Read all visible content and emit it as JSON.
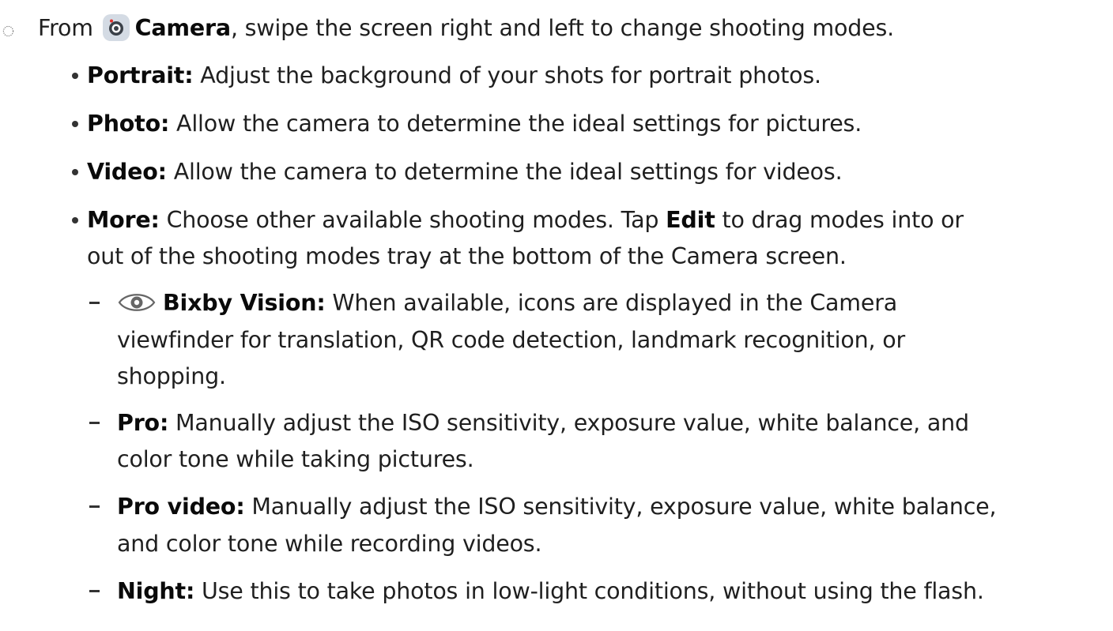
{
  "step": {
    "marker_icon": "dotted-circle-icon",
    "from": "From",
    "camera_icon": "camera-app-icon",
    "camera_label": "Camera",
    "text": ", swipe the screen right and left to change shooting modes."
  },
  "modes": [
    {
      "label": "Portrait",
      "colon": ":",
      "text": " Adjust the background of your shots for portrait photos."
    },
    {
      "label": "Photo",
      "colon": ":",
      "text": " Allow the camera to determine the ideal settings for pictures."
    },
    {
      "label": "Video",
      "colon": ":",
      "text": " Allow the camera to determine the ideal settings for videos."
    },
    {
      "label": "More",
      "colon": ":",
      "text1": " Choose other available shooting modes. Tap ",
      "edit_label": "Edit",
      "text2": " to drag modes into or",
      "text3": "out of the shooting modes tray at the bottom of the Camera screen."
    }
  ],
  "more_modes": [
    {
      "icon": "bixby-vision-eye-icon",
      "label": "Bixby Vision",
      "colon": ":",
      "lines": [
        " When available, icons are displayed in the Camera",
        "viewfinder for translation, QR code detection, landmark recognition, or",
        "shopping."
      ]
    },
    {
      "label": "Pro",
      "colon": ":",
      "lines": [
        " Manually adjust the ISO sensitivity, exposure value, white balance, and",
        "color tone while taking pictures."
      ]
    },
    {
      "label": "Pro video",
      "colon": ":",
      "lines": [
        " Manually adjust the ISO sensitivity, exposure value, white balance,",
        "and color tone while recording videos."
      ]
    },
    {
      "label": "Night",
      "colon": ":",
      "lines": [
        " Use this to take photos in low-light conditions, without using the flash."
      ]
    }
  ],
  "colors": {
    "text": "#1f1f1f",
    "camera_icon_bg": "#d4dbe4",
    "camera_lens": "#3a4048",
    "camera_dot": "#e2312b",
    "bixby_icon_stroke": "#666666"
  }
}
